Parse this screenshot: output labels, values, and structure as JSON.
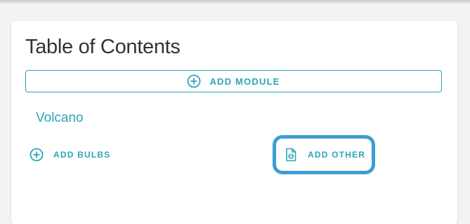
{
  "page": {
    "title": "Table of Contents"
  },
  "actions": {
    "add_module_label": "ADD MODULE",
    "add_bulbs_label": "ADD BULBS",
    "add_other_label": "ADD OTHER"
  },
  "modules": [
    {
      "name": "Volcano"
    }
  ],
  "icons": {
    "add_module": "plus-circle-icon",
    "add_bulbs": "plus-circle-icon",
    "add_other": "file-code-icon"
  },
  "colors": {
    "accent": "#2aa6b9",
    "highlight": "#3a9fd2",
    "title_text": "#333333",
    "page_bg": "#f3f3f3"
  }
}
